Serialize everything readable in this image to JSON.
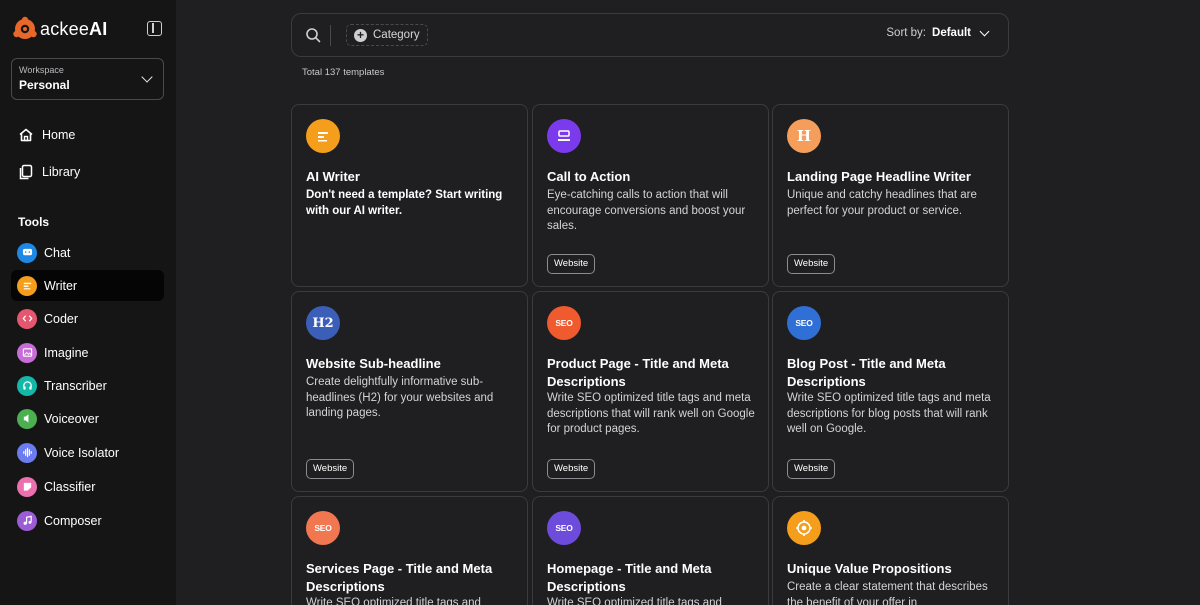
{
  "brand": {
    "prefix": "ackee",
    "suffix": "AI"
  },
  "workspace": {
    "label": "Workspace",
    "value": "Personal"
  },
  "nav": [
    {
      "label": "Home",
      "icon": "home-icon"
    },
    {
      "label": "Library",
      "icon": "library-icon"
    }
  ],
  "tools_heading": "Tools",
  "tools": [
    {
      "label": "Chat",
      "icon": "chat-icon",
      "color": "#1e88e5",
      "active": false
    },
    {
      "label": "Writer",
      "icon": "writer-icon",
      "color": "#f59e1b",
      "active": true
    },
    {
      "label": "Coder",
      "icon": "code-icon",
      "color": "#e5566f",
      "active": false
    },
    {
      "label": "Imagine",
      "icon": "image-icon",
      "color": "#c86dd7",
      "active": false
    },
    {
      "label": "Transcriber",
      "icon": "headphones-icon",
      "color": "#14b8a6",
      "active": false
    },
    {
      "label": "Voiceover",
      "icon": "voiceover-icon",
      "color": "#4caf50",
      "active": false
    },
    {
      "label": "Voice Isolator",
      "icon": "waveform-icon",
      "color": "#6b7bf0",
      "active": false
    },
    {
      "label": "Classifier",
      "icon": "classifier-icon",
      "color": "#ec6fb0",
      "active": false
    },
    {
      "label": "Composer",
      "icon": "composer-icon",
      "color": "#9b5cd6",
      "active": false
    }
  ],
  "search": {
    "category_label": "Category",
    "sort_label": "Sort by:",
    "sort_value": "Default"
  },
  "total_text": "Total 137 templates",
  "cards": [
    {
      "title": "AI Writer",
      "desc": "Don't need a template? Start writing with our AI writer.",
      "tag": "",
      "icon": "writer-icon",
      "icon_text": "",
      "color": "#f59e1b"
    },
    {
      "title": "Call to Action",
      "desc": "Eye-catching calls to action that will encourage conversions and boost your sales.",
      "tag": "Website",
      "icon": "cta-icon",
      "icon_text": "",
      "color": "#7c3aed"
    },
    {
      "title": "Landing Page Headline Writer",
      "desc": "Unique and catchy headlines that are perfect for your product or service.",
      "tag": "Website",
      "icon": "headline-icon",
      "icon_text": "H",
      "color": "#f59e5b"
    },
    {
      "title": "Website Sub-headline",
      "desc": "Create delightfully informative sub-headlines (H2) for your websites and landing pages.",
      "tag": "Website",
      "icon": "h2-icon",
      "icon_text": "H2",
      "color": "#3b5fb8"
    },
    {
      "title": "Product Page - Title and Meta Descriptions",
      "desc": "Write SEO optimized title tags and meta descriptions that will rank well on Google for product pages.",
      "tag": "Website",
      "icon": "seo-icon",
      "icon_text": "SEO",
      "color": "#ef5a2e"
    },
    {
      "title": "Blog Post - Title and Meta Descriptions",
      "desc": "Write SEO optimized title tags and meta descriptions for blog posts that will rank well on Google.",
      "tag": "Website",
      "icon": "seo-icon",
      "icon_text": "SEO",
      "color": "#2f6fd6"
    },
    {
      "title": "Services Page - Title and Meta Descriptions",
      "desc": "Write SEO optimized title tags and",
      "tag": "",
      "icon": "seo-icon",
      "icon_text": "SEO",
      "color": "#f0774f"
    },
    {
      "title": "Homepage - Title and Meta Descriptions",
      "desc": "Write SEO optimized title tags and",
      "tag": "",
      "icon": "seo-icon",
      "icon_text": "SEO",
      "color": "#6d4bdb"
    },
    {
      "title": "Unique Value Propositions",
      "desc": "Create a clear statement that describes the benefit of your offer in",
      "tag": "",
      "icon": "target-icon",
      "icon_text": "",
      "color": "#f59e1b"
    }
  ]
}
